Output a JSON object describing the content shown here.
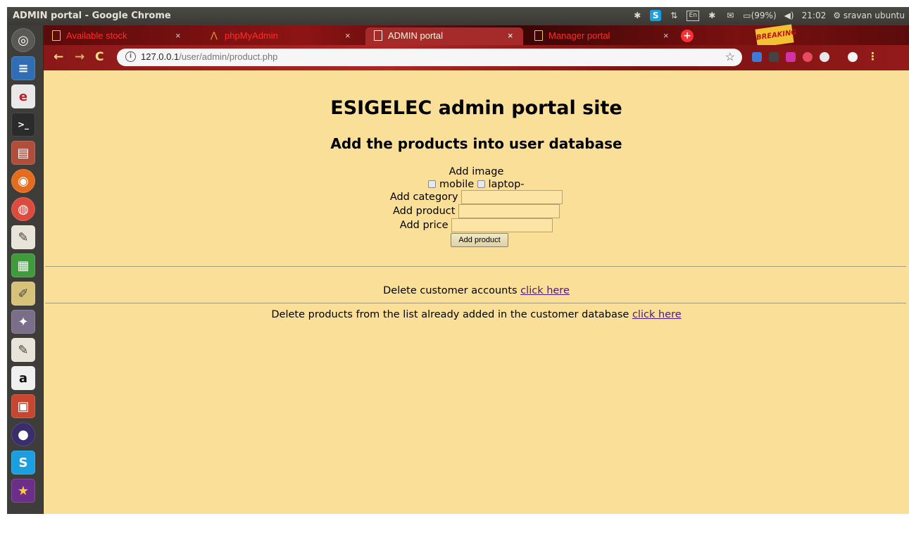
{
  "system": {
    "window_title": "ADMIN portal - Google Chrome",
    "battery": "(99%)",
    "time": "21:02",
    "user": "sravan ubuntu",
    "lang": "En"
  },
  "tabs": [
    {
      "label": "Available stock"
    },
    {
      "label": "phpMyAdmin"
    },
    {
      "label": "ADMIN portal"
    },
    {
      "label": "Manager portal"
    }
  ],
  "omnibox": {
    "host": "127.0.0.1",
    "path": "/user/admin/product.php"
  },
  "page": {
    "title": "ESIGELEC admin portal site",
    "subtitle": "Add the products into user database",
    "add_image_label": "Add image",
    "checkbox_mobile": "mobile",
    "checkbox_laptop": "laptop-",
    "category_label": "Add category",
    "product_label": "Add product",
    "price_label": "Add price",
    "submit_label": "Add product",
    "delete_accounts_text": "Delete customer accounts",
    "delete_accounts_link": "click here",
    "delete_products_text": "Delete products from the list already added in the customer database",
    "delete_products_link": "click here"
  }
}
